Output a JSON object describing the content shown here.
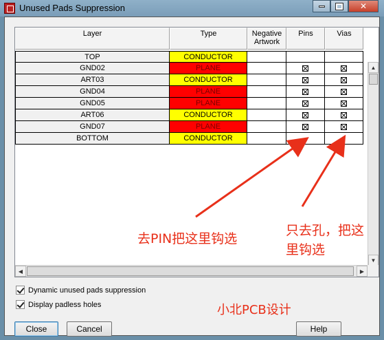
{
  "window": {
    "title": "Unused Pads Suppression",
    "controls": {
      "minimize": "minimize",
      "maximize": "maximize",
      "close": "close"
    }
  },
  "grid": {
    "columns": [
      "Layer",
      "Type",
      "Negative\nArtwork",
      "Pins",
      "Vias"
    ],
    "rows": [
      {
        "layer": "TOP",
        "type": "CONDUCTOR",
        "type_color": "#ffff00",
        "pins": false,
        "vias": false
      },
      {
        "layer": "GND02",
        "type": "PLANE",
        "type_color": "#ff0000",
        "pins": true,
        "vias": true
      },
      {
        "layer": "ART03",
        "type": "CONDUCTOR",
        "type_color": "#ffff00",
        "pins": true,
        "vias": true
      },
      {
        "layer": "GND04",
        "type": "PLANE",
        "type_color": "#ff0000",
        "pins": true,
        "vias": true
      },
      {
        "layer": "GND05",
        "type": "PLANE",
        "type_color": "#ff0000",
        "pins": true,
        "vias": true
      },
      {
        "layer": "ART06",
        "type": "CONDUCTOR",
        "type_color": "#ffff00",
        "pins": true,
        "vias": true
      },
      {
        "layer": "GND07",
        "type": "PLANE",
        "type_color": "#ff0000",
        "pins": true,
        "vias": true
      },
      {
        "layer": "BOTTOM",
        "type": "CONDUCTOR",
        "type_color": "#ffff00",
        "pins": false,
        "vias": false
      }
    ]
  },
  "options": {
    "dynamic_suppression": {
      "label": "Dynamic unused pads suppression",
      "checked": true
    },
    "padless_holes": {
      "label": "Display padless holes",
      "checked": true
    }
  },
  "buttons": {
    "close": "Close",
    "cancel": "Cancel",
    "help": "Help"
  },
  "annotations": {
    "pins_note": "去PIN把这里钩选",
    "vias_note_line1": "只去孔，把这",
    "vias_note_line2": "里钩选",
    "watermark": "小北PCB设计",
    "color": "#e8301a"
  }
}
